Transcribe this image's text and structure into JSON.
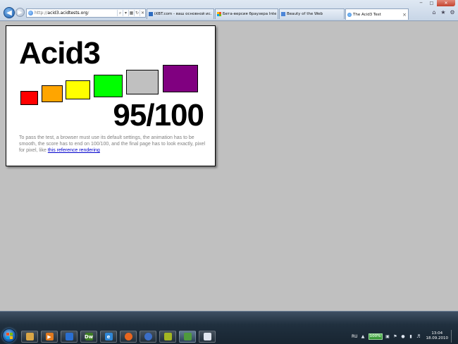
{
  "browser": {
    "address": {
      "url_prefix": "http://",
      "url_host": "acid3.acidtests.org",
      "url_suffix": "/"
    },
    "tabs": [
      {
        "title": "iXBT.com - ваш основной ис...",
        "active": false
      },
      {
        "title": "Бета-версия браузера Interne...",
        "active": false
      },
      {
        "title": "Beauty of the Web",
        "active": false
      },
      {
        "title": "The Acid3 Test",
        "active": true
      }
    ],
    "active_tab_close": "×"
  },
  "acid3": {
    "title": "Acid3",
    "score": "95/100",
    "description": "To pass the test, a browser must use its default settings, the animation has to be smooth, the score has to end on 100/100, and the final page has to look exactly, pixel for pixel, like ",
    "link_text": "this reference rendering",
    "bucket_colors": [
      "#ff0000",
      "#ffa500",
      "#ffff00",
      "#00ff00",
      "#c0c0c0",
      "#800080"
    ]
  },
  "taskbar": {
    "apps": [
      {
        "name": "explorer",
        "color": "#d9a646"
      },
      {
        "name": "media-player",
        "color": "#e07a1f"
      },
      {
        "name": "save",
        "color": "#2a6fd1"
      },
      {
        "name": "dreamweaver",
        "label": "Dw",
        "color": "#3e7d25"
      },
      {
        "name": "internet-explorer",
        "label": "e",
        "color": "#2f86d6"
      },
      {
        "name": "firefox",
        "color": "#e8661f"
      },
      {
        "name": "thunderbird",
        "color": "#3b6ec7"
      },
      {
        "name": "utility",
        "color": "#a3b622"
      },
      {
        "name": "media-center",
        "color": "#4f9a3c"
      },
      {
        "name": "document",
        "color": "#e0e6ef"
      }
    ],
    "tray": {
      "language": "RU",
      "battery": "100%",
      "time": "13:04",
      "date": "18.09.2010"
    }
  }
}
